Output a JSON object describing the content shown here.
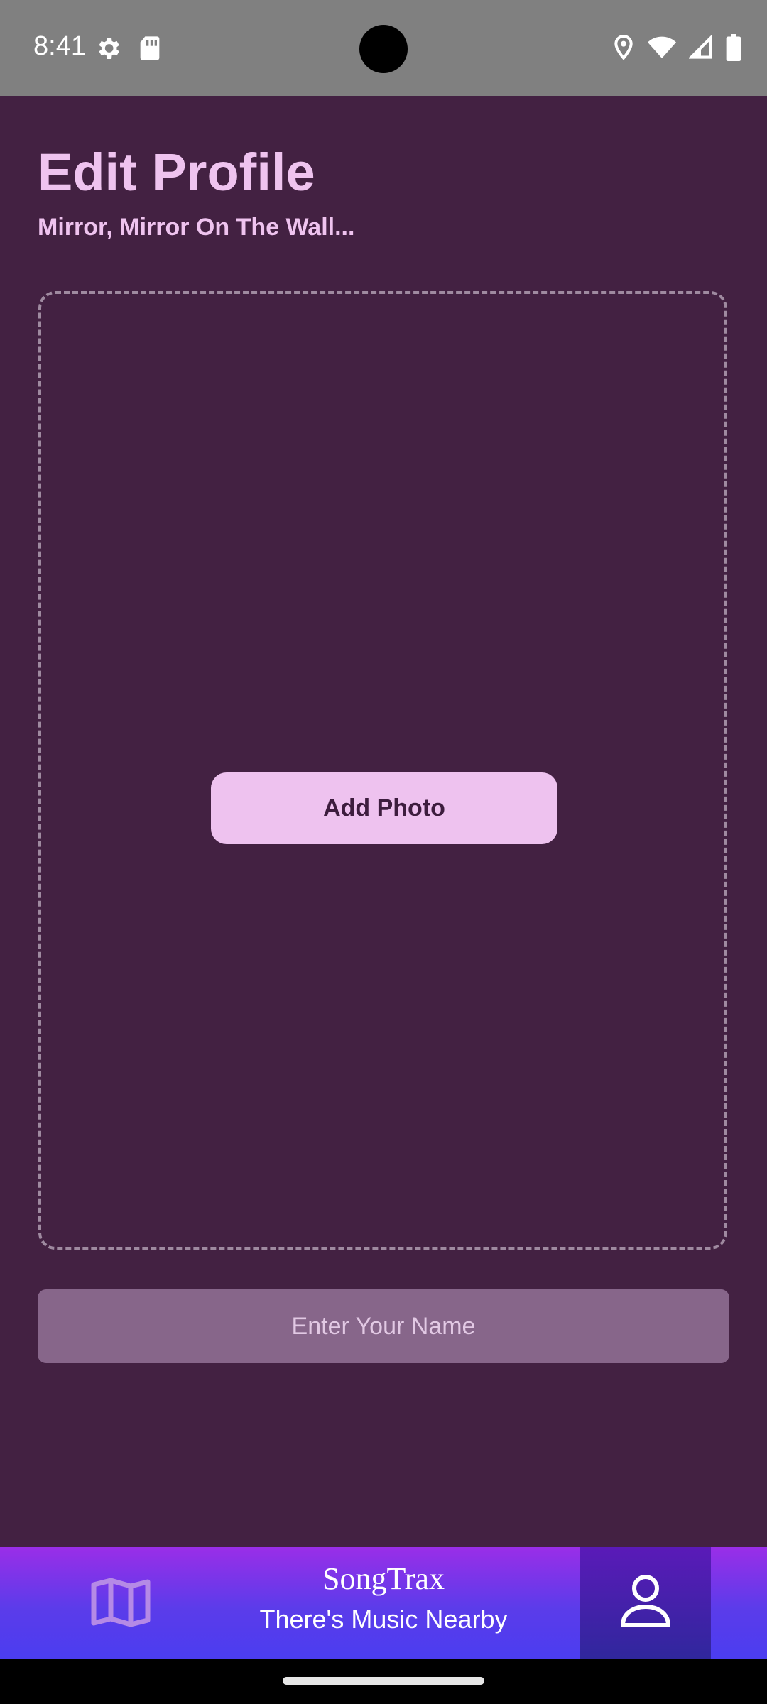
{
  "status_bar": {
    "time": "8:41",
    "left_icons": [
      "settings-icon",
      "sd-card-icon"
    ],
    "right_icons": [
      "location-icon",
      "wifi-icon",
      "signal-icon",
      "battery-icon"
    ]
  },
  "header": {
    "title": "Edit Profile",
    "subtitle": "Mirror, Mirror On The Wall..."
  },
  "photo": {
    "add_button_label": "Add Photo"
  },
  "name_field": {
    "placeholder": "Enter Your Name",
    "value": ""
  },
  "bottom_nav": {
    "map_icon": "map-icon",
    "brand_title": "SongTrax",
    "brand_tagline": "There's Music Nearby",
    "profile_icon": "person-icon",
    "active_tab": "profile"
  },
  "colors": {
    "background": "#432142",
    "accent_text": "#efc3ef",
    "button_bg": "#eec2ef",
    "input_bg": "#87668a",
    "nav_gradient_top": "#9a2ee8",
    "nav_gradient_bottom": "#4b3df0"
  }
}
